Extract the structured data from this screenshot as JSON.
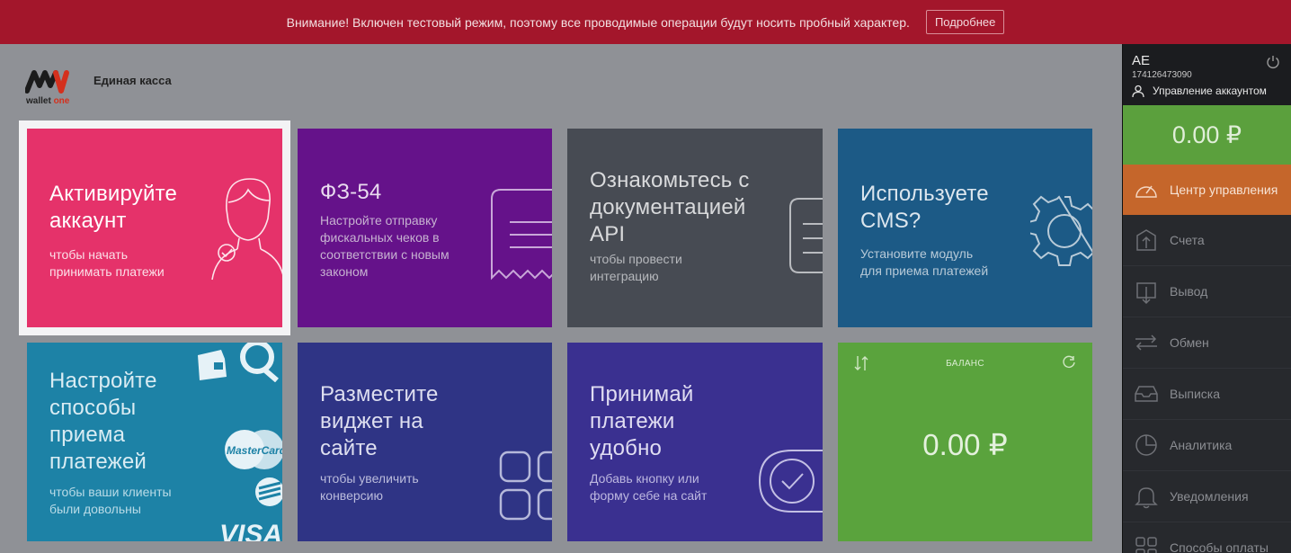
{
  "banner": {
    "message": "Внимание! Включен тестовый режим, поэтому все проводимые операции будут носить пробный характер.",
    "more_button": "Подробнее"
  },
  "header": {
    "logo_word": "wallet",
    "logo_word_accent": "one",
    "app_title": "Единая касса"
  },
  "tiles": [
    {
      "title_line1": "Активируйте",
      "title_line2": "аккаунт",
      "sub_line1": "чтобы начать",
      "sub_line2": "принимать платежи",
      "color": "#e5326a"
    },
    {
      "title_line1": "ФЗ-54",
      "sub_line1": "Настройте отправку",
      "sub_line2": "фискальных чеков в",
      "sub_line3": "соответствии с новым",
      "sub_line4": "законом",
      "color": "#65128a"
    },
    {
      "title_line1": "Ознакомьтесь с",
      "title_line2": "документацией",
      "title_line3": "API",
      "sub_line1": "чтобы провести",
      "sub_line2": "интеграцию",
      "color": "#474b53"
    },
    {
      "title_line1": "Используете",
      "title_line2": "CMS?",
      "sub_line1": "Установите модуль",
      "sub_line2": "для приема платежей",
      "color": "#1c5a86"
    },
    {
      "title_line1": "Настройте",
      "title_line2": "способы",
      "title_line3": "приема",
      "title_line4": "платежей",
      "sub_line1": "чтобы ваши клиенты",
      "sub_line2": "были довольны",
      "color": "#1d82a6"
    },
    {
      "title_line1": "Разместите",
      "title_line2": "виджет на",
      "title_line3": "сайте",
      "sub_line1": "чтобы увеличить",
      "sub_line2": "конверсию",
      "color": "#2f3485"
    },
    {
      "title_line1": "Принимай",
      "title_line2": "платежи",
      "title_line3": "удобно",
      "sub_line1": "Добавь кнопку или",
      "sub_line2": "форму себе на сайт",
      "color": "#3a3090"
    },
    {
      "label": "БАЛАНС",
      "amount": "0.00 ₽",
      "color": "#5aa33d"
    }
  ],
  "tile5_brands": {
    "mastercard": "MasterCard",
    "visa": "VISA"
  },
  "sidebar": {
    "user_initials": "AE",
    "user_id": "174126473090",
    "account_link": "Управление аккаунтом",
    "balance": "0.00 ₽",
    "items": [
      {
        "label": "Центр управления",
        "icon": "gauge-icon",
        "active": true
      },
      {
        "label": "Счета",
        "icon": "invoice-icon"
      },
      {
        "label": "Вывод",
        "icon": "withdraw-icon"
      },
      {
        "label": "Обмен",
        "icon": "exchange-icon"
      },
      {
        "label": "Выписка",
        "icon": "tray-icon"
      },
      {
        "label": "Аналитика",
        "icon": "pie-icon"
      },
      {
        "label": "Уведомления",
        "icon": "bell-icon"
      },
      {
        "label": "Способы оплаты",
        "icon": "grid-icon"
      }
    ]
  },
  "colors": {
    "banner": "#a3162b",
    "active_nav": "#c5662b",
    "balance_green": "#5ba03d"
  }
}
